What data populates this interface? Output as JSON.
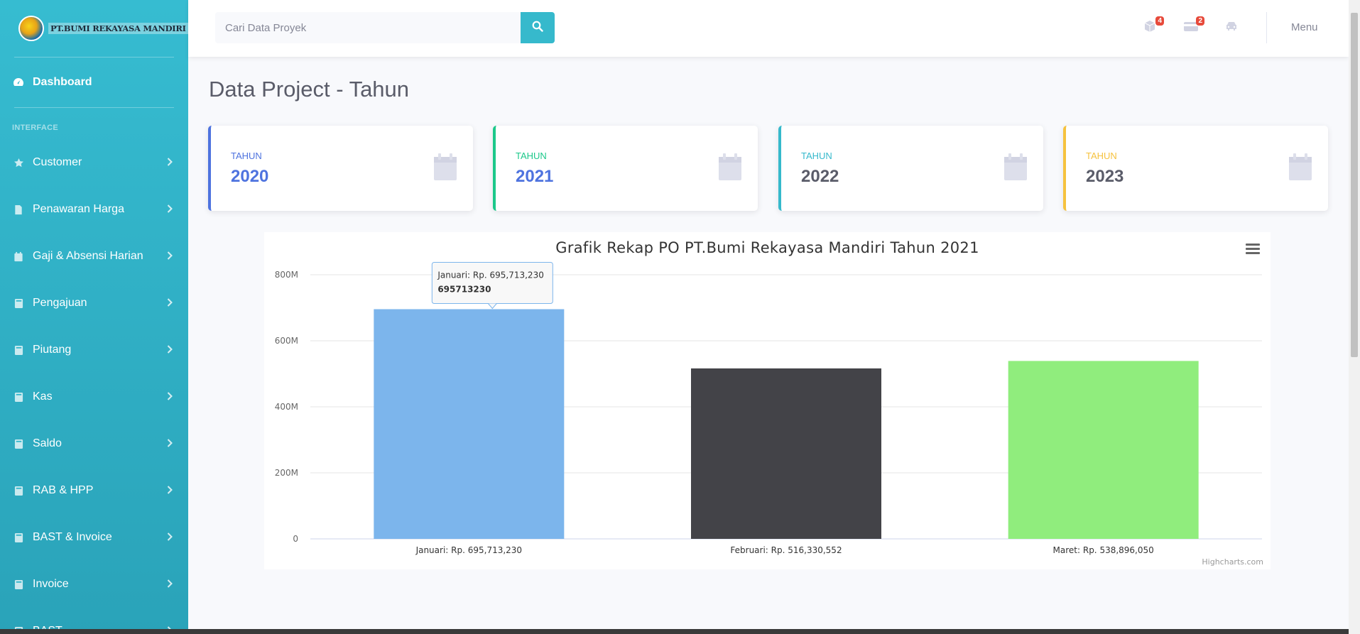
{
  "brand": {
    "name": "PT.BUMI REKAYASA MANDIRI"
  },
  "sidebar": {
    "dashboard": {
      "label": "Dashboard",
      "icon": "tachometer-icon"
    },
    "section_heading": "INTERFACE",
    "items": [
      {
        "label": "Customer",
        "icon": "star-icon"
      },
      {
        "label": "Penawaran Harga",
        "icon": "file-icon"
      },
      {
        "label": "Gaji & Absensi Harian",
        "icon": "calendar-icon"
      },
      {
        "label": "Pengajuan",
        "icon": "book-icon"
      },
      {
        "label": "Piutang",
        "icon": "book-icon"
      },
      {
        "label": "Kas",
        "icon": "book-icon"
      },
      {
        "label": "Saldo",
        "icon": "book-icon"
      },
      {
        "label": "RAB & HPP",
        "icon": "book-icon"
      },
      {
        "label": "BAST & Invoice",
        "icon": "book-icon"
      },
      {
        "label": "Invoice",
        "icon": "book-icon"
      },
      {
        "label": "BAST",
        "icon": "book-icon"
      }
    ]
  },
  "topbar": {
    "search_placeholder": "Cari Data Proyek",
    "badges": {
      "box": "4",
      "card": "2"
    },
    "menu_label": "Menu"
  },
  "page": {
    "title": "Data Project - Tahun"
  },
  "cards": [
    {
      "label": "TAHUN",
      "value": "2020",
      "accent": "#4e73df",
      "label_color": "#4e73df",
      "value_color": "#4e73df"
    },
    {
      "label": "TAHUN",
      "value": "2021",
      "accent": "#1cc88a",
      "label_color": "#1cc88a",
      "value_color": "#4e73df"
    },
    {
      "label": "TAHUN",
      "value": "2022",
      "accent": "#36b9cc",
      "label_color": "#36b9cc",
      "value_color": "#5a5c69"
    },
    {
      "label": "TAHUN",
      "value": "2023",
      "accent": "#f6c23e",
      "label_color": "#f6c23e",
      "value_color": "#5a5c69"
    }
  ],
  "chart_data": {
    "type": "bar",
    "title": "Grafik Rekap PO PT.Bumi Rekayasa Mandiri Tahun 2021",
    "categories": [
      "Januari: Rp. 695,713,230",
      "Februari: Rp. 516,330,552",
      "Maret: Rp. 538,896,050"
    ],
    "values": [
      695713230,
      516330552,
      538896050
    ],
    "colors": [
      "#7cb5ec",
      "#434348",
      "#90ed7d"
    ],
    "ylim": [
      0,
      800000000
    ],
    "yticks": [
      {
        "value": 0,
        "label": "0"
      },
      {
        "value": 200000000,
        "label": "200M"
      },
      {
        "value": 400000000,
        "label": "400M"
      },
      {
        "value": 600000000,
        "label": "600M"
      },
      {
        "value": 800000000,
        "label": "800M"
      }
    ],
    "grid": true,
    "legend": "none",
    "tooltip": {
      "category": "Januari: Rp. 695,713,230",
      "value": "695713230"
    },
    "credit": "Highcharts.com"
  }
}
